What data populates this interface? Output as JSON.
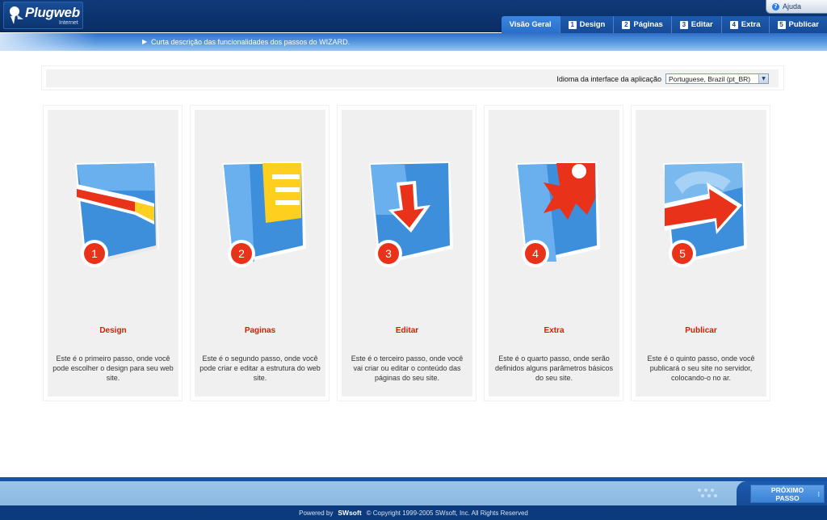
{
  "app": {
    "brand": "Plugweb",
    "brand_sub": "Internet",
    "help_label": "Ajuda"
  },
  "nav": {
    "tabs": [
      {
        "num": "",
        "label": "Visão Geral",
        "active": true
      },
      {
        "num": "1",
        "label": "Design",
        "active": false
      },
      {
        "num": "2",
        "label": "Páginas",
        "active": false
      },
      {
        "num": "3",
        "label": "Editar",
        "active": false
      },
      {
        "num": "4",
        "label": "Extra",
        "active": false
      },
      {
        "num": "5",
        "label": "Publicar",
        "active": false
      }
    ],
    "subtitle": "Curta descrição das funcionalidades dos passos do WIZARD."
  },
  "language": {
    "label": "Idioma da interface da aplicação",
    "selected": "Portuguese, Brazil (pt_BR)"
  },
  "steps": [
    {
      "number": "1",
      "title": "Design",
      "description": "Este é o primeiro passo, onde você pode escolher o design para seu web site.",
      "icon": "design-step-icon"
    },
    {
      "number": "2",
      "title": "Paginas",
      "description": "Este é o segundo passo, onde você pode criar e editar a estrutura do web site.",
      "icon": "pages-step-icon"
    },
    {
      "number": "3",
      "title": "Editar",
      "description": "Este é o terceiro passo, onde você vai criar ou editar o conteúdo das páginas do seu site.",
      "icon": "edit-step-icon"
    },
    {
      "number": "4",
      "title": "Extra",
      "description": "Este é o quarto passo, onde serão definidos alguns parâmetros básicos do seu site.",
      "icon": "extra-step-icon"
    },
    {
      "number": "5",
      "title": "Publicar",
      "description": "Este é o quinto passo, onde você publicará o seu site no servidor, colocando-o no ar.",
      "icon": "publish-step-icon"
    }
  ],
  "footer": {
    "next_line1": "PRÓXIMO",
    "next_line2": "PASSO",
    "powered_by": "Powered by",
    "powered_brand": "SWsoft",
    "copyright": "© Copyright 1999-2005 SWsoft, Inc. All Rights Reserved"
  },
  "colors": {
    "header_dark": "#0a2d63",
    "accent_blue": "#2a6fca",
    "step_title_red": "#d81b00",
    "card_bg": "#f0f0f0"
  }
}
